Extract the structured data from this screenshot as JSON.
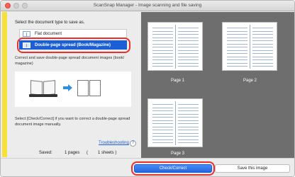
{
  "window": {
    "title": "ScanSnap Manager - Image scanning and file saving"
  },
  "left": {
    "prompt": "Select the document type to save as.",
    "options": [
      {
        "label": "Flat document",
        "selected": false
      },
      {
        "label": "Double-page spread (Book/Magazine)",
        "selected": true
      }
    ],
    "description": "Correct and save double-page spread document images (book/ magazine)",
    "check_hint": "Select [Check/Correct] if you want to correct a double-page spread document image manually.",
    "troubleshooting": "Troubleshooting",
    "help": "?",
    "saved": {
      "label": "Saved:",
      "pages": "1 pages",
      "open": "(",
      "sheets": "1 sheets )"
    }
  },
  "preview": {
    "pages": [
      {
        "label": "Page 1"
      },
      {
        "label": "Page 2"
      },
      {
        "label": "Page 3"
      }
    ]
  },
  "footer": {
    "check_label": "Check/Correct",
    "save_label": "Save this image"
  },
  "colors": {
    "accent": "#f6e03a",
    "selection": "#1a5fd6",
    "highlight_ring": "#e8302d"
  }
}
